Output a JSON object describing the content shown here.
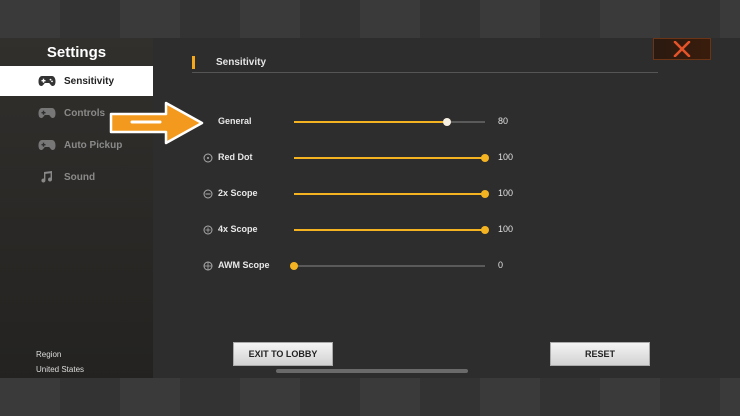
{
  "sidebar": {
    "title": "Settings",
    "items": [
      {
        "label": "Sensitivity",
        "icon": "gamepad-icon",
        "active": true
      },
      {
        "label": "Controls",
        "icon": "gamepad-icon",
        "active": false
      },
      {
        "label": "Auto Pickup",
        "icon": "gamepad-icon",
        "active": false
      },
      {
        "label": "Sound",
        "icon": "music-note-icon",
        "active": false
      }
    ],
    "region_label": "Region",
    "region_value": "United States"
  },
  "main": {
    "section_title": "Sensitivity",
    "settings": [
      {
        "label": "General",
        "value": "80",
        "fraction": 0.8
      },
      {
        "label": "Red Dot",
        "value": "100",
        "fraction": 1.0
      },
      {
        "label": "2x Scope",
        "value": "100",
        "fraction": 1.0
      },
      {
        "label": "4x Scope",
        "value": "100",
        "fraction": 1.0
      },
      {
        "label": "AWM Scope",
        "value": "0",
        "fraction": 0.0
      }
    ],
    "exit_label": "EXIT TO LOBBY",
    "reset_label": "RESET"
  },
  "colors": {
    "accent": "#f4b321",
    "arrow": "#f39a1e",
    "close": "#e5532a"
  }
}
